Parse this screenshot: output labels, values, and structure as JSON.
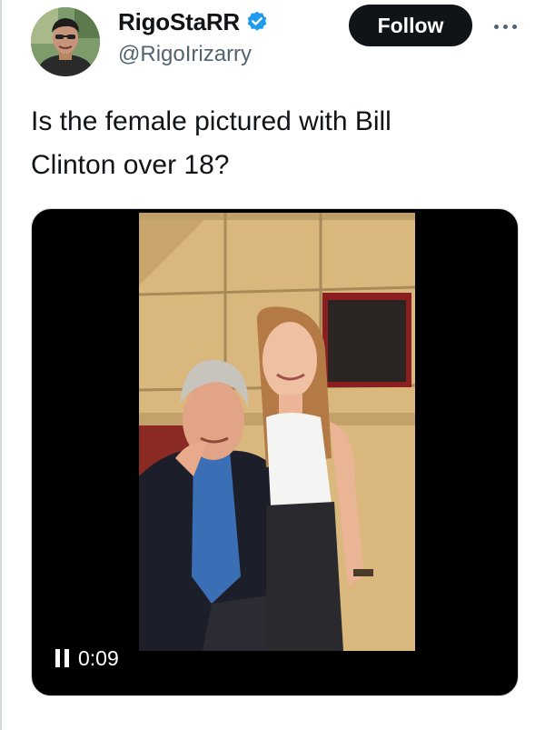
{
  "author": {
    "display_name": "RigoStaRR",
    "handle": "@RigoIrizarry",
    "verified": true
  },
  "actions": {
    "follow_label": "Follow",
    "more_icon": "more-horizontal-icon"
  },
  "tweet": {
    "text": "Is the female pictured with Bill\nClinton over 18?"
  },
  "media": {
    "type": "video",
    "elapsed_time": "0:09",
    "state_icon": "pause-icon"
  },
  "colors": {
    "follow_bg": "#0f1419",
    "verified_blue": "#1d9bf0",
    "secondary_text": "#536471",
    "media_bg": "#000000"
  }
}
